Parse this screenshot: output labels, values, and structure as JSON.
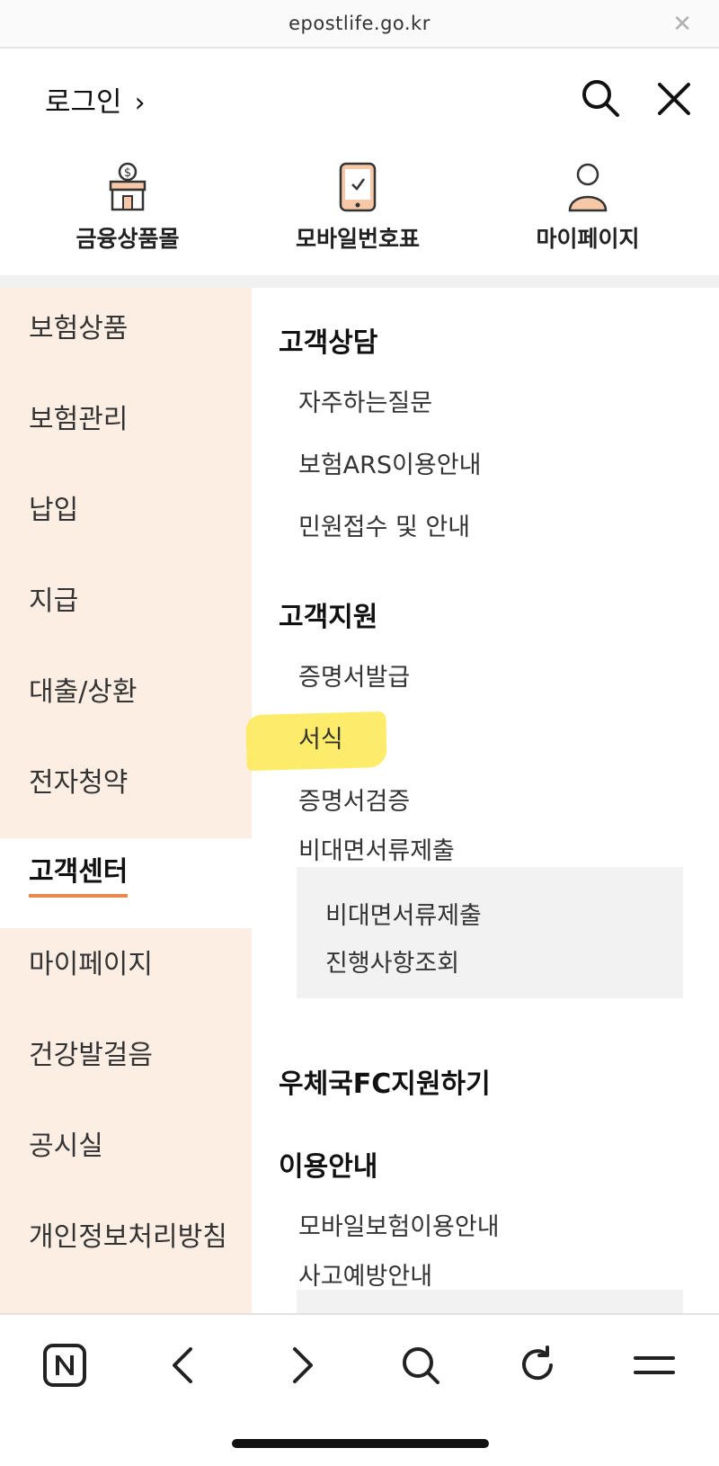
{
  "browser": {
    "url": "epostlife.go.kr",
    "close_icon": "close-icon"
  },
  "header": {
    "login_label": "로그인",
    "login_chevron": "›",
    "search_icon": "search-icon",
    "close_icon": "close-icon"
  },
  "quick_links": [
    {
      "label": "금융상품몰",
      "icon": "shop-icon"
    },
    {
      "label": "모바일번호표",
      "icon": "mobile-ticket-icon"
    },
    {
      "label": "마이페이지",
      "icon": "person-icon"
    }
  ],
  "left_nav": {
    "items": [
      "보험상품",
      "보험관리",
      "납입",
      "지급",
      "대출/상환",
      "전자청약",
      "고객센터",
      "마이페이지",
      "건강발걸음",
      "공시실",
      "개인정보처리방침"
    ],
    "active": "고객센터"
  },
  "content": {
    "sections": [
      {
        "title": "고객상담",
        "items": [
          "자주하는질문",
          "보험ARS이용안내",
          "민원접수 및 안내"
        ]
      },
      {
        "title": "고객지원",
        "items": [
          "증명서발급",
          "서식",
          "증명서검증",
          "비대면서류제출"
        ],
        "subitems": [
          "비대면서류제출",
          "진행사항조회"
        ],
        "highlighted": "서식"
      },
      {
        "title": "우체국FC지원하기",
        "items": []
      },
      {
        "title": "이용안내",
        "items": [
          "모바일보험이용안내",
          "사고예방안내"
        ]
      }
    ]
  },
  "toolbar": {
    "icons": [
      "naver-icon",
      "back-icon",
      "forward-icon",
      "search-icon",
      "refresh-icon",
      "menu-icon"
    ]
  },
  "colors": {
    "nav_bg": "#fdeee4",
    "accent": "#e7894b",
    "highlight": "#fde95a",
    "subbox_bg": "#f2f2f2"
  }
}
